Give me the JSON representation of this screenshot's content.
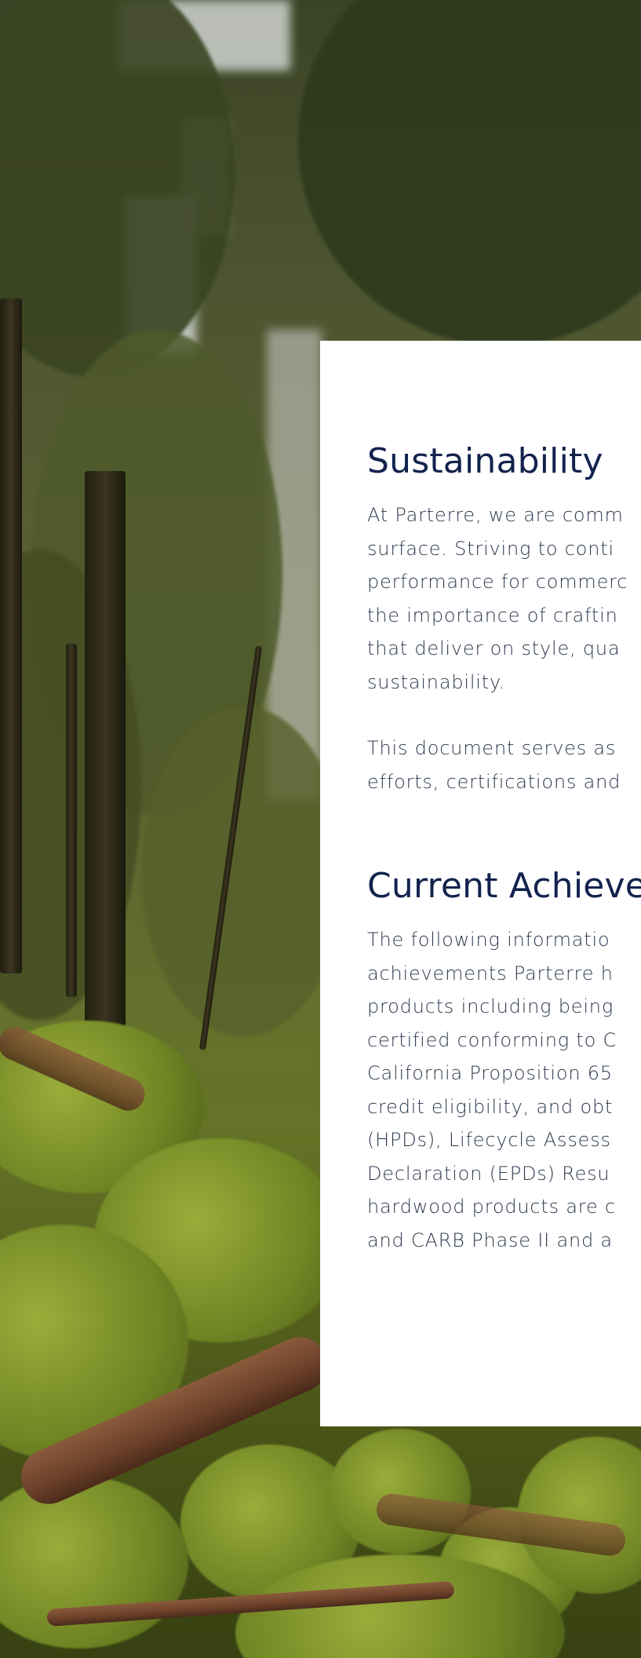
{
  "sections": [
    {
      "heading": "Sustainability",
      "paragraphs": [
        [
          "At Parterre, we are comm",
          "surface. Striving to conti",
          "performance for commerc",
          "the importance of craftin",
          "that deliver on style, qua",
          "sustainability."
        ],
        [
          "This document serves as",
          "efforts, certifications and"
        ]
      ]
    },
    {
      "heading": "Current Achieve",
      "paragraphs": [
        [
          "The following informatio",
          "achievements Parterre h",
          "products including being",
          "certified conforming to C",
          "California Proposition 65",
          "credit eligibility, and obt",
          "(HPDs), Lifecycle Assess",
          "Declaration (EPDs) Resu",
          "hardwood products are c",
          "and CARB Phase II and a"
        ]
      ]
    }
  ],
  "colors": {
    "heading": "#13234e",
    "body_text": "#2d3a4e",
    "card": "#ffffff"
  }
}
